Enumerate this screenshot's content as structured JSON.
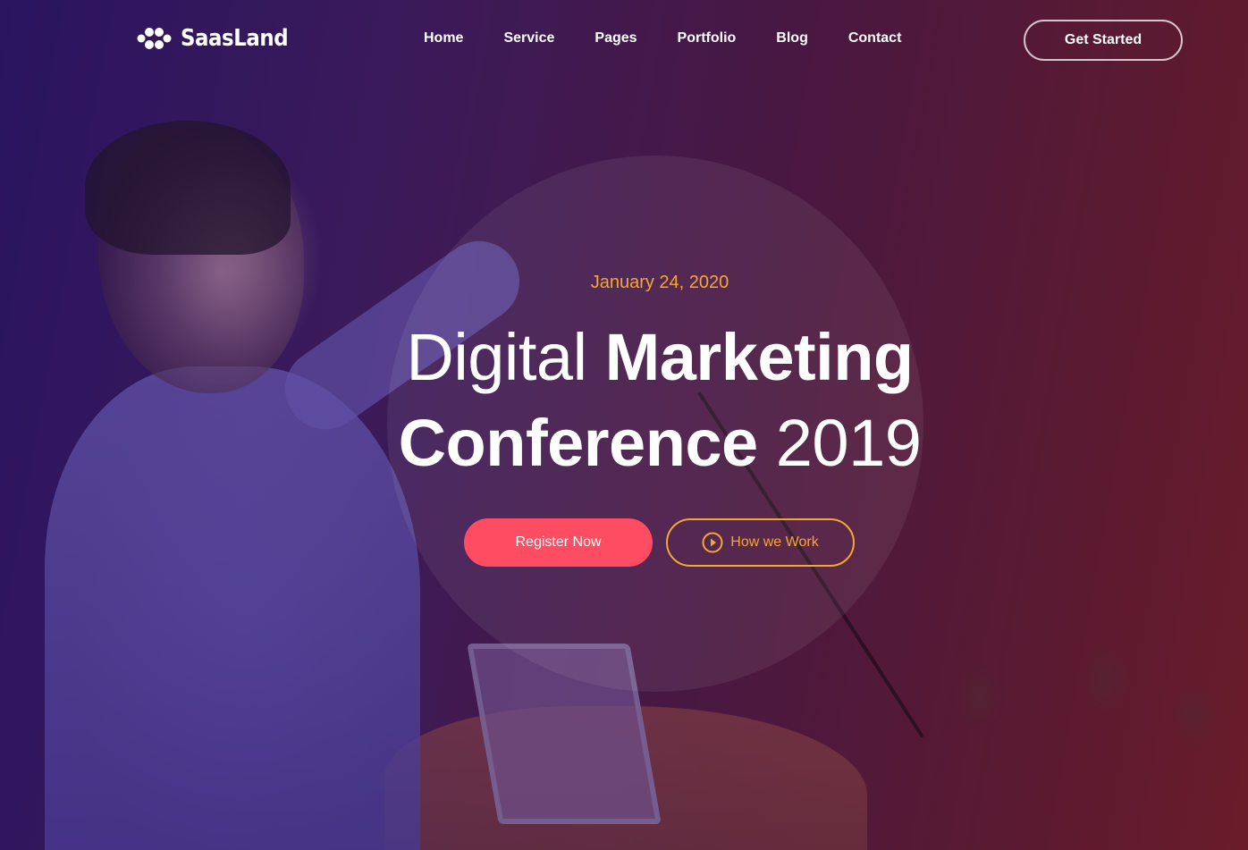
{
  "brand": {
    "name": "SaasLand",
    "logo_icon": "dots-cluster-icon"
  },
  "nav": {
    "items": [
      {
        "label": "Home"
      },
      {
        "label": "Service"
      },
      {
        "label": "Pages"
      },
      {
        "label": "Portfolio"
      },
      {
        "label": "Blog"
      },
      {
        "label": "Contact"
      }
    ],
    "cta_label": "Get Started"
  },
  "hero": {
    "date": "January 24, 2020",
    "title_part1_light": "Digital ",
    "title_part1_bold": "Marketing",
    "title_part2_bold": "Conference ",
    "title_part2_light": "2019",
    "primary_button": "Register Now",
    "secondary_button": "How we Work",
    "secondary_icon": "play-circle-icon"
  },
  "colors": {
    "accent_orange": "#f5a733",
    "accent_red": "#fe4d62",
    "text_white": "#ffffff"
  }
}
